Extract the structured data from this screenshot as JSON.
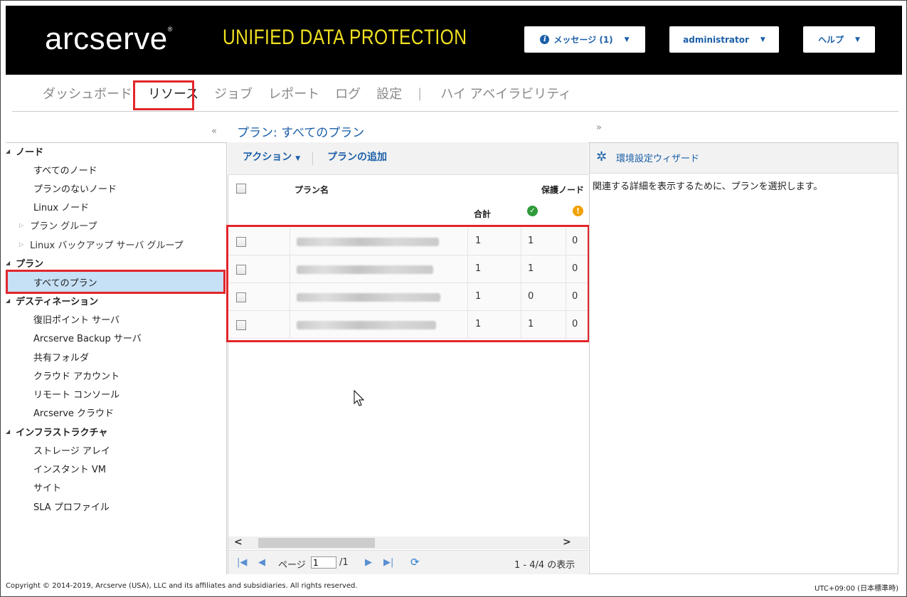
{
  "header": {
    "logo": "arcserve",
    "logo_mark": "®",
    "product": "UNIFIED DATA PROTECTION",
    "messages_label": "メッセージ (1)",
    "user_label": "administrator",
    "help_label": "ヘルプ"
  },
  "topnav": {
    "items": [
      "ダッシュボード",
      "リソース",
      "ジョブ",
      "レポート",
      "ログ",
      "設定"
    ],
    "separator": "|",
    "ha": "ハイ アベイラビリティ",
    "active": "リソース"
  },
  "left": {
    "collapse_glyph": "«",
    "nodes_label": "ノード",
    "nodes_items": [
      "すべてのノード",
      "プランのないノード",
      "Linux ノード"
    ],
    "plan_group": "プラン グループ",
    "linux_backup_group": "Linux バックアップ サーバ グループ",
    "plans_label": "プラン",
    "all_plans": "すべてのプラン",
    "dest_label": "デスティネーション",
    "dest_items": [
      "復旧ポイント サーバ",
      "Arcserve Backup サーバ",
      "共有フォルダ",
      "クラウド アカウント",
      "リモート コンソール",
      "Arcserve クラウド"
    ],
    "infra_label": "インフラストラクチャ",
    "infra_items": [
      "ストレージ アレイ",
      "インスタント VM",
      "サイト",
      "SLA プロファイル"
    ]
  },
  "center": {
    "title": "プラン: すべてのプラン",
    "action_label": "アクション",
    "add_plan_label": "プランの追加",
    "columns": {
      "plan_name": "プラン名",
      "protected_nodes": "保護ノード",
      "total": "合計"
    },
    "rows": [
      {
        "total": "1",
        "ok": "1",
        "warn": "0"
      },
      {
        "total": "1",
        "ok": "1",
        "warn": "0"
      },
      {
        "total": "1",
        "ok": "0",
        "warn": "0"
      },
      {
        "total": "1",
        "ok": "1",
        "warn": "0"
      }
    ],
    "pager": {
      "page_label": "ページ",
      "page_value": "1",
      "page_total": "/1",
      "display": "1 - 4/4 の表示"
    }
  },
  "right": {
    "expand_glyph": "»",
    "wizard_label": "環境設定ウィザード",
    "message": "関連する詳細を表示するために、プランを選択します。"
  },
  "footer": {
    "copyright": "Copyright © 2014-2019, Arcserve (USA), LLC and its affiliates and subsidiaries. All rights reserved.",
    "timezone": "UTC+09:00 (日本標準時)"
  },
  "colors": {
    "accent": "#1b5fa8",
    "highlight": "#e2262b",
    "selection": "#c6e0f5",
    "ok": "#2e9c3a",
    "warn": "#f0a000",
    "product_text": "#f0e020"
  }
}
